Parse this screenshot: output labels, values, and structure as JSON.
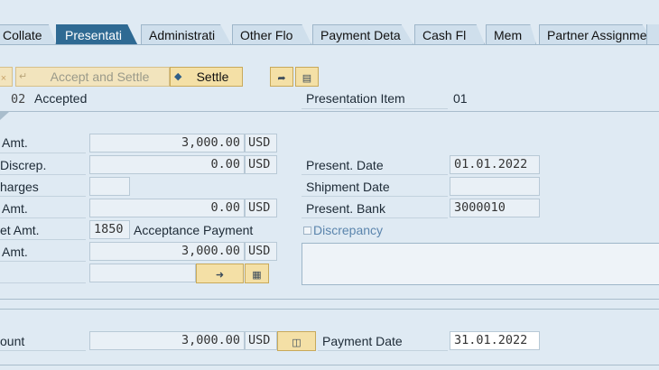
{
  "tabs": [
    {
      "label": "Collate",
      "active": false
    },
    {
      "label": "Presentati",
      "active": true
    },
    {
      "label": "Administrati",
      "active": false
    },
    {
      "label": "Other Flo",
      "active": false
    },
    {
      "label": "Payment Deta",
      "active": false
    },
    {
      "label": "Cash Fl",
      "active": false
    },
    {
      "label": "Mem",
      "active": false
    },
    {
      "label": "Partner Assignme",
      "active": false
    }
  ],
  "toolbar": {
    "cancel_icon": "×",
    "accept_settle_label": "Accept and Settle",
    "settle_label": "Settle"
  },
  "status": {
    "code": "02",
    "text": "Accepted",
    "presentation_item_label": "Presentation Item",
    "presentation_item_value": "01"
  },
  "left": {
    "amt_label": "Amt.",
    "amt_value": "3,000.00",
    "amt_unit": "USD",
    "discrep_label": "Discrep.",
    "discrep_value": "0.00",
    "discrep_unit": "USD",
    "charges_label": "harges",
    "charges_value": "",
    "amt2_label": "Amt.",
    "amt2_value": "0.00",
    "amt2_unit": "USD",
    "et_amt_label": "et Amt.",
    "et_amt_code": "1850",
    "et_amt_text": "Acceptance Payment",
    "amt3_label": "Amt.",
    "amt3_value": "3,000.00",
    "amt3_unit": "USD"
  },
  "right": {
    "present_date_label": "Present. Date",
    "present_date_value": "01.01.2022",
    "shipment_date_label": "Shipment Date",
    "shipment_date_value": "",
    "present_bank_label": "Present. Bank",
    "present_bank_value": "3000010",
    "discrepancy_label": "Discrepancy"
  },
  "bottom": {
    "amount_label": "ount",
    "amount_value": "3,000.00",
    "amount_unit": "USD",
    "payment_date_label": "Payment Date",
    "payment_date_value": "31.01.2022"
  }
}
